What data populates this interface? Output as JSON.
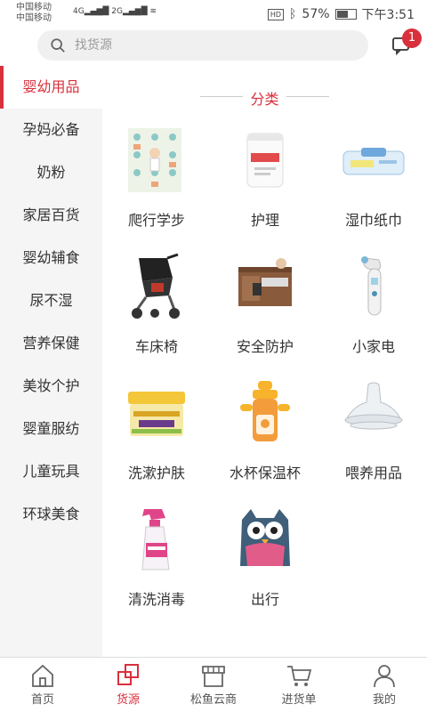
{
  "status": {
    "carrier1": "中国移动",
    "carrier2": "中国移动",
    "net1": "4G",
    "net2": "2G",
    "battery": "57%",
    "time": "下午3:51"
  },
  "search": {
    "placeholder": "找货源",
    "icon": "search-icon"
  },
  "messages": {
    "badge": "1",
    "icon": "chat-icon"
  },
  "sidebar": {
    "items": [
      {
        "label": "婴幼用品",
        "active": true
      },
      {
        "label": "孕妈必备"
      },
      {
        "label": "奶粉"
      },
      {
        "label": "家居百货"
      },
      {
        "label": "婴幼辅食"
      },
      {
        "label": "尿不湿"
      },
      {
        "label": "营养保健"
      },
      {
        "label": "美妆个护"
      },
      {
        "label": "婴童服纺"
      },
      {
        "label": "儿童玩具"
      },
      {
        "label": "环球美食"
      }
    ]
  },
  "section": {
    "title": "分类"
  },
  "categories": [
    {
      "label": "爬行学步",
      "icon": "play-mat-icon"
    },
    {
      "label": "护理",
      "icon": "cotton-swab-icon"
    },
    {
      "label": "湿巾纸巾",
      "icon": "wipes-icon"
    },
    {
      "label": "车床椅",
      "icon": "stroller-icon"
    },
    {
      "label": "安全防护",
      "icon": "safety-lock-icon"
    },
    {
      "label": "小家电",
      "icon": "thermometer-icon"
    },
    {
      "label": "洗漱护肤",
      "icon": "cream-jar-icon"
    },
    {
      "label": "水杯保温杯",
      "icon": "sippy-cup-icon"
    },
    {
      "label": "喂养用品",
      "icon": "nipple-icon"
    },
    {
      "label": "清洗消毒",
      "icon": "spray-bottle-icon"
    },
    {
      "label": "出行",
      "icon": "owl-backpack-icon"
    }
  ],
  "tabbar": {
    "items": [
      {
        "label": "首页",
        "icon": "home-icon"
      },
      {
        "label": "货源",
        "icon": "squares-icon",
        "active": true
      },
      {
        "label": "松鱼云商",
        "icon": "store-icon"
      },
      {
        "label": "进货单",
        "icon": "cart-icon"
      },
      {
        "label": "我的",
        "icon": "user-icon"
      }
    ]
  },
  "colors": {
    "accent": "#d9303d",
    "sidebar_bg": "#f5f5f5"
  }
}
